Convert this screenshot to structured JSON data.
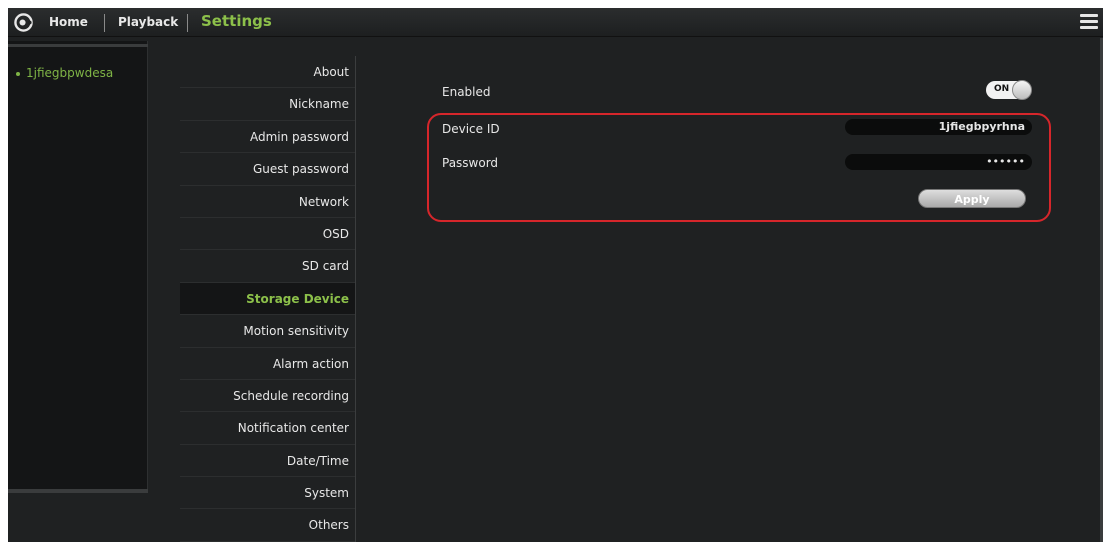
{
  "topbar": {
    "home_label": "Home",
    "playback_label": "Playback",
    "settings_label": "Settings",
    "logo_icon": "camera-logo-icon",
    "menu_icon": "hamburger-menu-icon"
  },
  "devices": [
    {
      "name": "1jfiegbpwdesa"
    }
  ],
  "settings_menu": [
    {
      "label": "About"
    },
    {
      "label": "Nickname"
    },
    {
      "label": "Admin password"
    },
    {
      "label": "Guest password"
    },
    {
      "label": "Network"
    },
    {
      "label": "OSD"
    },
    {
      "label": "SD card"
    },
    {
      "label": "Storage Device",
      "active": true
    },
    {
      "label": "Motion sensitivity"
    },
    {
      "label": "Alarm action"
    },
    {
      "label": "Schedule recording"
    },
    {
      "label": "Notification center"
    },
    {
      "label": "Date/Time"
    },
    {
      "label": "System"
    },
    {
      "label": "Others"
    }
  ],
  "storage": {
    "enabled_label": "Enabled",
    "toggle_text": "ON",
    "device_id_label": "Device ID",
    "device_id_value": "1jfiegbpyrhna",
    "password_label": "Password",
    "password_value": "••••••",
    "apply_label": "Apply"
  },
  "colors": {
    "accent": "#8cc04a",
    "highlight_frame": "#d6262b",
    "background": "#1f2122"
  }
}
